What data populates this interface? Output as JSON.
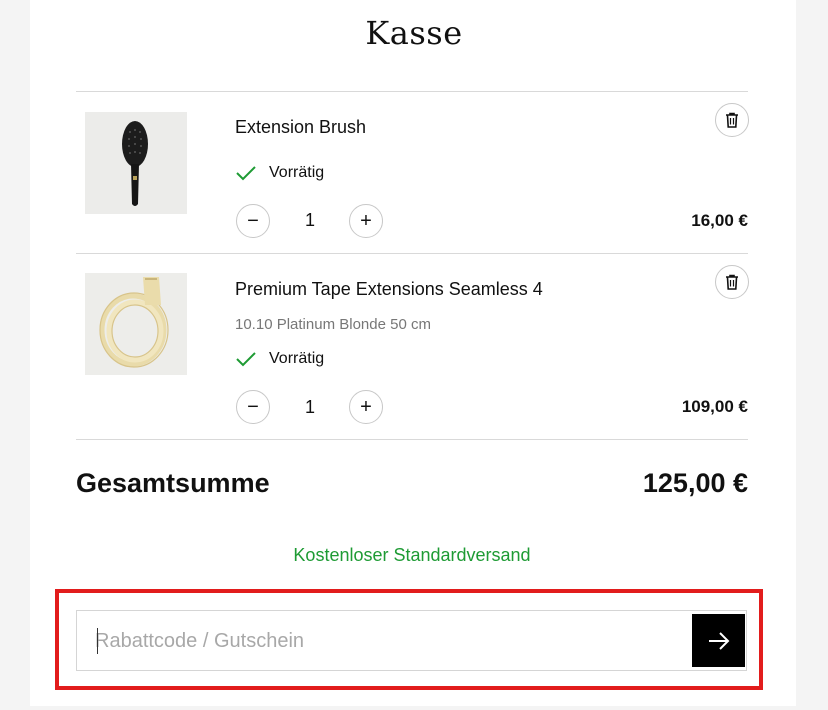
{
  "page": {
    "title": "Kasse"
  },
  "items": [
    {
      "name": "Extension Brush",
      "variant": "",
      "stock": "Vorrätig",
      "quantity": "1",
      "price": "16,00 €",
      "image_icon": "hair-brush-image"
    },
    {
      "name": "Premium Tape Extensions Seamless 4",
      "variant": "10.10 Platinum Blonde 50 cm",
      "stock": "Vorrätig",
      "quantity": "1",
      "price": "109,00 €",
      "image_icon": "blonde-hair-extension-image"
    }
  ],
  "buttons": {
    "decrease": "−",
    "increase": "+"
  },
  "icons": {
    "remove": "trash-icon",
    "stock": "check-icon",
    "submit": "arrow-right-icon"
  },
  "summary": {
    "total_label": "Gesamtsumme",
    "total_value": "125,00 €"
  },
  "shipping": {
    "text": "Kostenloser Standardversand"
  },
  "coupon": {
    "placeholder": "Rabattcode / Gutschein",
    "value": ""
  },
  "colors": {
    "accent_green": "#1e9b34",
    "highlight_red": "#e21c1c",
    "button_black": "#000000"
  }
}
